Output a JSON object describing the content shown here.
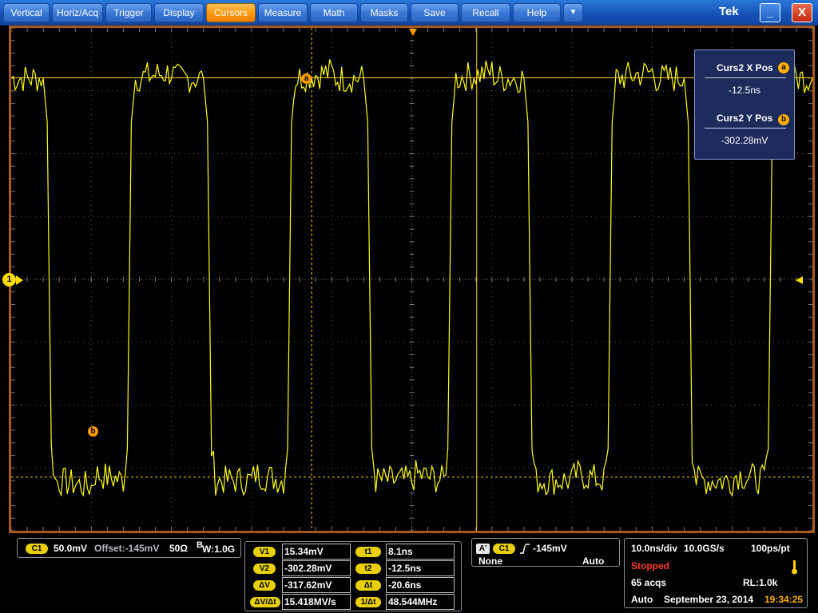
{
  "menu": {
    "items": [
      {
        "label": "Vertical"
      },
      {
        "label": "Horiz/Acq"
      },
      {
        "label": "Trigger"
      },
      {
        "label": "Display"
      },
      {
        "label": "Cursors"
      },
      {
        "label": "Measure"
      },
      {
        "label": "Math"
      },
      {
        "label": "Masks"
      },
      {
        "label": "Save"
      },
      {
        "label": "Recall"
      },
      {
        "label": "Help"
      }
    ],
    "active": "Cursors",
    "dropdown_label": "▼",
    "brand": "Tek",
    "minimize_label": "_",
    "close_label": "X"
  },
  "readout": {
    "x_label": "Curs2 X Pos",
    "x_badge": "a",
    "x_value": "-12.5ns",
    "y_label": "Curs2 Y Pos",
    "y_badge": "b",
    "y_value": "-302.28mV"
  },
  "markers": {
    "channel": "1",
    "cursor_a": "a",
    "cursor_b": "b"
  },
  "channel_panel": {
    "chip": "C1",
    "scale": "50.0mV",
    "offset": "Offset:-145mV",
    "impedance": "50Ω",
    "bw_b": "B",
    "bw_rest": "W:1.0G"
  },
  "cursor_panel": {
    "v_rows": [
      {
        "chip": "V1",
        "value": "15.34mV"
      },
      {
        "chip": "V2",
        "value": "-302.28mV"
      },
      {
        "chip": "ΔV",
        "value": "-317.62mV"
      },
      {
        "chip": "ΔV/Δt",
        "value": "15.418MV/s"
      }
    ],
    "t_rows": [
      {
        "chip": "t1",
        "value": "8.1ns"
      },
      {
        "chip": "t2",
        "value": "-12.5ns"
      },
      {
        "chip": "Δt",
        "value": "-20.6ns"
      },
      {
        "chip": "1/Δt",
        "value": "48.544MHz"
      }
    ]
  },
  "trigger_panel": {
    "a_chip": "A'",
    "chip": "C1",
    "level": "-145mV",
    "coupling": "None",
    "mode": "Auto"
  },
  "acq_panel": {
    "timebase": "10.0ns/div",
    "sample_rate": "10.0GS/s",
    "resolution": "100ps/pt",
    "status": "Stopped",
    "acqs": "65 acqs",
    "record_length": "RL:1.0k",
    "trigger_mode": "Auto",
    "date": "September 23, 2014",
    "time": "19:34:25"
  },
  "colors": {
    "trace": "#ffff00",
    "cursor": "#ffd000",
    "accent_orange": "#ff9a00",
    "border": "#a85a1c",
    "status_stopped": "#ff3b2b"
  },
  "chart_data": {
    "type": "line",
    "timebase": "10.0ns/div",
    "volts_per_div": "50.0mV",
    "offset": "-145mV",
    "x_unit": "ns",
    "y_unit": "mV",
    "xlim": [
      -50,
      50
    ],
    "ylim": [
      -345,
      55
    ],
    "series": [
      {
        "x": [
          -50,
          -49.5,
          -46,
          -45.5,
          -45,
          -44.5,
          -40,
          -39.5,
          -36,
          -35.5,
          -35,
          -34.5,
          -30,
          -29.5,
          -26,
          -25.5,
          -25,
          -24.5,
          -20,
          -19.5,
          -16,
          -15.5,
          -15,
          -14.5,
          -10,
          -9.5,
          -6,
          -5.5,
          -5,
          -4.5,
          0,
          0.5,
          4,
          4.5,
          5,
          5.5,
          10,
          10.5,
          14,
          14.5,
          15,
          15.5,
          20,
          20.5,
          24,
          24.5,
          25,
          25.5,
          30,
          30.5,
          34,
          34.5,
          35,
          35.5,
          40,
          40.5,
          44,
          44.5,
          45,
          45.5,
          50
        ],
        "y": [
          15,
          15,
          15,
          -20,
          -280,
          -305,
          -310,
          -300,
          -305,
          -280,
          -20,
          15,
          20,
          15,
          15,
          -20,
          -280,
          -305,
          -305,
          -300,
          -305,
          -280,
          -20,
          15,
          20,
          15,
          15,
          -20,
          -280,
          -305,
          -305,
          -300,
          -305,
          -280,
          -20,
          15,
          20,
          15,
          15,
          -20,
          -280,
          -305,
          -305,
          -300,
          -305,
          -280,
          -20,
          15,
          20,
          15,
          15,
          -20,
          -280,
          -305,
          -305,
          -300,
          -305,
          -280,
          -20,
          15,
          15
        ]
      }
    ],
    "cursors": {
      "t1": 8.1,
      "t2": -12.5,
      "v1": 15.34,
      "v2": -302.28
    }
  }
}
